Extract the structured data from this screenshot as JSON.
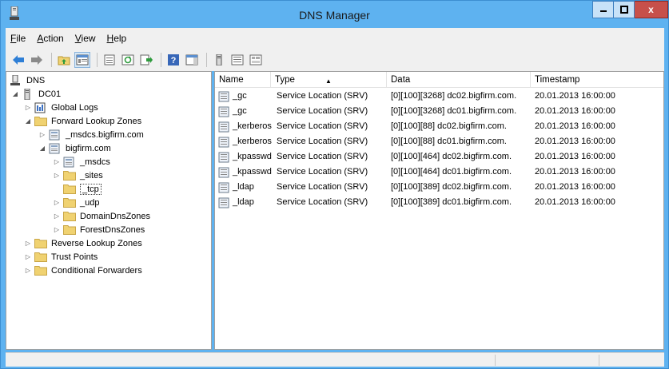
{
  "window": {
    "title": "DNS Manager",
    "close_glyph": "x"
  },
  "menu": [
    {
      "label": "File",
      "hotkey": "F",
      "rest": "ile"
    },
    {
      "label": "Action",
      "hotkey": "A",
      "rest": "ction"
    },
    {
      "label": "View",
      "hotkey": "V",
      "rest": "iew"
    },
    {
      "label": "Help",
      "hotkey": "H",
      "rest": "elp"
    }
  ],
  "toolbar": [
    "back-arrow-icon",
    "forward-arrow-icon",
    "up-folder-icon",
    "show-tree-icon",
    "properties-icon",
    "refresh-icon",
    "export-list-icon",
    "help-icon",
    "show-hide-icon",
    "server-icon",
    "list-view-icon",
    "detail-view-icon"
  ],
  "tree": {
    "root": "DNS",
    "server": "DC01",
    "global_logs": "Global Logs",
    "forward_zones": "Forward Lookup Zones",
    "msdcs_zone": "_msdcs.bigfirm.com",
    "bigfirm_zone": "bigfirm.com",
    "msdcs": "_msdcs",
    "sites": "_sites",
    "tcp": "_tcp",
    "udp": "_udp",
    "domain_dns": "DomainDnsZones",
    "forest_dns": "ForestDnsZones",
    "reverse_zones": "Reverse Lookup Zones",
    "trust_points": "Trust Points",
    "conditional_forwarders": "Conditional Forwarders"
  },
  "list": {
    "columns": [
      "Name",
      "Type",
      "Data",
      "Timestamp"
    ],
    "sorted_column": "Type",
    "rows": [
      {
        "name": "_gc",
        "type": "Service Location (SRV)",
        "data": "[0][100][3268] dc02.bigfirm.com.",
        "timestamp": "20.01.2013 16:00:00"
      },
      {
        "name": "_gc",
        "type": "Service Location (SRV)",
        "data": "[0][100][3268] dc01.bigfirm.com.",
        "timestamp": "20.01.2013 16:00:00"
      },
      {
        "name": "_kerberos",
        "type": "Service Location (SRV)",
        "data": "[0][100][88] dc02.bigfirm.com.",
        "timestamp": "20.01.2013 16:00:00"
      },
      {
        "name": "_kerberos",
        "type": "Service Location (SRV)",
        "data": "[0][100][88] dc01.bigfirm.com.",
        "timestamp": "20.01.2013 16:00:00"
      },
      {
        "name": "_kpasswd",
        "type": "Service Location (SRV)",
        "data": "[0][100][464] dc02.bigfirm.com.",
        "timestamp": "20.01.2013 16:00:00"
      },
      {
        "name": "_kpasswd",
        "type": "Service Location (SRV)",
        "data": "[0][100][464] dc01.bigfirm.com.",
        "timestamp": "20.01.2013 16:00:00"
      },
      {
        "name": "_ldap",
        "type": "Service Location (SRV)",
        "data": "[0][100][389] dc02.bigfirm.com.",
        "timestamp": "20.01.2013 16:00:00"
      },
      {
        "name": "_ldap",
        "type": "Service Location (SRV)",
        "data": "[0][100][389] dc01.bigfirm.com.",
        "timestamp": "20.01.2013 16:00:00"
      }
    ]
  },
  "colors": {
    "title_bar": "#5eb2f0",
    "close_button": "#c7504a",
    "folder": "#f0d271"
  }
}
